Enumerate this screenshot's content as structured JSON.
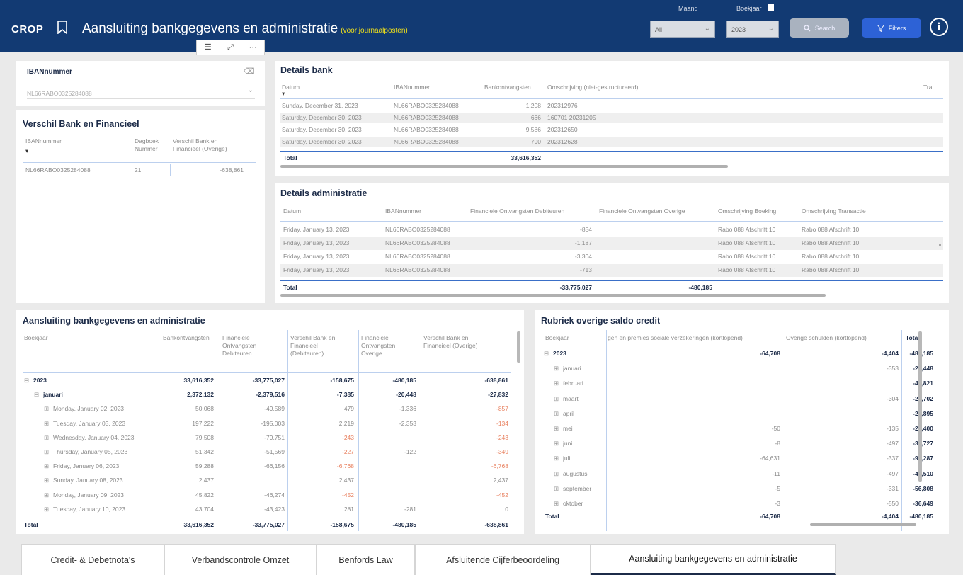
{
  "header": {
    "logo": "CROP",
    "title": "Aansluiting bankgegevens en administratie",
    "subtitle": "(voor journaalposten)",
    "maand_label": "Maand",
    "maand_value": "All",
    "boekjaar_label": "Boekjaar",
    "boekjaar_value": "2023",
    "search_label": "Search",
    "filters_label": "Filters",
    "info": "i"
  },
  "iban_slicer": {
    "title": "IBANnummer",
    "value": "NL66RABO0325284088"
  },
  "verschil": {
    "title": "Verschil Bank en Financieel",
    "col1": "IBANnummer",
    "col2a": "Dagboek",
    "col2b": "Nummer",
    "col3a": "Verschil Bank en",
    "col3b": "Financieel (Overige)",
    "row": {
      "iban": "NL66RABO0325284088",
      "dagboek": "21",
      "verschil": "-638,861"
    }
  },
  "details_bank": {
    "title": "Details bank",
    "headers": [
      "Datum",
      "IBANnummer",
      "Bankontvangsten",
      "Omschrijving (niet-gestructureerd)",
      "Tra"
    ],
    "rows": [
      [
        "Sunday, December 31, 2023",
        "NL66RABO0325284088",
        "1,208",
        "202312976"
      ],
      [
        "Saturday, December 30, 2023",
        "NL66RABO0325284088",
        "666",
        "160701 20231205"
      ],
      [
        "Saturday, December 30, 2023",
        "NL66RABO0325284088",
        "9,586",
        "202312650"
      ],
      [
        "Saturday, December 30, 2023",
        "NL66RABO0325284088",
        "790",
        "202312628"
      ]
    ],
    "total_label": "Total",
    "total_value": "33,616,352"
  },
  "details_admin": {
    "title": "Details administratie",
    "headers": [
      "Datum",
      "IBANnummer",
      "Financiele Ontvangsten Debiteuren",
      "Financiele Ontvangsten Overige",
      "Omschrijving Boeking",
      "Omschrijving Transactie"
    ],
    "rows": [
      [
        "Friday, January 13, 2023",
        "NL66RABO0325284088",
        "-854",
        "",
        "Rabo 088 Afschrift 10",
        "Rabo 088 Afschrift 10"
      ],
      [
        "Friday, January 13, 2023",
        "NL66RABO0325284088",
        "-1,187",
        "",
        "Rabo 088 Afschrift 10",
        "Rabo 088 Afschrift 10"
      ],
      [
        "Friday, January 13, 2023",
        "NL66RABO0325284088",
        "-3,304",
        "",
        "Rabo 088 Afschrift 10",
        "Rabo 088 Afschrift 10"
      ],
      [
        "Friday, January 13, 2023",
        "NL66RABO0325284088",
        "-713",
        "",
        "Rabo 088 Afschrift 10",
        "Rabo 088 Afschrift 10"
      ]
    ],
    "total_label": "Total",
    "total_deb": "-33,775,027",
    "total_ov": "-480,185"
  },
  "aansluiting": {
    "title": "Aansluiting bankgegevens en administratie",
    "headers": [
      "Boekjaar",
      "Bankontvangsten",
      "Financiele Ontvangsten Debiteuren",
      "Verschil Bank en Financieel (Debiteuren)",
      "Financiele Ontvangsten Overige",
      "Verschil Bank en Financieel (Overige)"
    ],
    "rows": [
      {
        "label": "2023",
        "level": 0,
        "toggle": "⊟",
        "bold": true,
        "v": [
          "33,616,352",
          "-33,775,027",
          "-158,675",
          "-480,185",
          "-638,861"
        ],
        "red": [
          false,
          false,
          false,
          false,
          false
        ]
      },
      {
        "label": "januari",
        "level": 1,
        "toggle": "⊟",
        "bold": true,
        "v": [
          "2,372,132",
          "-2,379,516",
          "-7,385",
          "-20,448",
          "-27,832"
        ],
        "red": [
          false,
          false,
          false,
          false,
          false
        ]
      },
      {
        "label": "Monday, January 02, 2023",
        "level": 2,
        "toggle": "⊞",
        "bold": false,
        "v": [
          "50,068",
          "-49,589",
          "479",
          "-1,336",
          "-857"
        ],
        "red": [
          false,
          false,
          false,
          false,
          true
        ]
      },
      {
        "label": "Tuesday, January 03, 2023",
        "level": 2,
        "toggle": "⊞",
        "bold": false,
        "v": [
          "197,222",
          "-195,003",
          "2,219",
          "-2,353",
          "-134"
        ],
        "red": [
          false,
          false,
          false,
          false,
          true
        ]
      },
      {
        "label": "Wednesday, January 04, 2023",
        "level": 2,
        "toggle": "⊞",
        "bold": false,
        "v": [
          "79,508",
          "-79,751",
          "-243",
          "",
          "-243"
        ],
        "red": [
          false,
          false,
          true,
          false,
          true
        ]
      },
      {
        "label": "Thursday, January 05, 2023",
        "level": 2,
        "toggle": "⊞",
        "bold": false,
        "v": [
          "51,342",
          "-51,569",
          "-227",
          "-122",
          "-349"
        ],
        "red": [
          false,
          false,
          true,
          false,
          true
        ]
      },
      {
        "label": "Friday, January 06, 2023",
        "level": 2,
        "toggle": "⊞",
        "bold": false,
        "v": [
          "59,288",
          "-66,156",
          "-6,768",
          "",
          "-6,768"
        ],
        "red": [
          false,
          false,
          true,
          false,
          true
        ]
      },
      {
        "label": "Sunday, January 08, 2023",
        "level": 2,
        "toggle": "⊞",
        "bold": false,
        "v": [
          "2,437",
          "",
          "2,437",
          "",
          "2,437"
        ],
        "red": [
          false,
          false,
          false,
          false,
          false
        ]
      },
      {
        "label": "Monday, January 09, 2023",
        "level": 2,
        "toggle": "⊞",
        "bold": false,
        "v": [
          "45,822",
          "-46,274",
          "-452",
          "",
          "-452"
        ],
        "red": [
          false,
          false,
          true,
          false,
          true
        ]
      },
      {
        "label": "Tuesday, January 10, 2023",
        "level": 2,
        "toggle": "⊞",
        "bold": false,
        "v": [
          "43,704",
          "-43,423",
          "281",
          "-281",
          "0"
        ],
        "red": [
          false,
          false,
          false,
          false,
          false
        ]
      }
    ],
    "total": [
      "Total",
      "33,616,352",
      "-33,775,027",
      "-158,675",
      "-480,185",
      "-638,861"
    ]
  },
  "rubriek": {
    "title": "Rubriek overige saldo credit",
    "headers": [
      "Boekjaar",
      "gen en premies sociale verzekeringen (kortlopend)",
      "Overige schulden (kortlopend)",
      "Total"
    ],
    "rows": [
      {
        "label": "2023",
        "level": 0,
        "toggle": "⊟",
        "bold": true,
        "v": [
          "-64,708",
          "-4,404",
          "-480,185"
        ]
      },
      {
        "label": "januari",
        "level": 1,
        "toggle": "⊞",
        "bold": false,
        "v": [
          "",
          "-353",
          "-20,448"
        ]
      },
      {
        "label": "februari",
        "level": 1,
        "toggle": "⊞",
        "bold": false,
        "v": [
          "",
          "",
          "-41,821"
        ]
      },
      {
        "label": "maart",
        "level": 1,
        "toggle": "⊞",
        "bold": false,
        "v": [
          "",
          "-304",
          "-23,702"
        ]
      },
      {
        "label": "april",
        "level": 1,
        "toggle": "⊞",
        "bold": false,
        "v": [
          "",
          "",
          "-29,895"
        ]
      },
      {
        "label": "mei",
        "level": 1,
        "toggle": "⊞",
        "bold": false,
        "v": [
          "-50",
          "-135",
          "-28,400"
        ]
      },
      {
        "label": "juni",
        "level": 1,
        "toggle": "⊞",
        "bold": false,
        "v": [
          "-8",
          "-497",
          "-30,727"
        ]
      },
      {
        "label": "juli",
        "level": 1,
        "toggle": "⊞",
        "bold": false,
        "v": [
          "-64,631",
          "-337",
          "-95,287"
        ]
      },
      {
        "label": "augustus",
        "level": 1,
        "toggle": "⊞",
        "bold": false,
        "v": [
          "-11",
          "-497",
          "-44,510"
        ]
      },
      {
        "label": "september",
        "level": 1,
        "toggle": "⊞",
        "bold": false,
        "v": [
          "-5",
          "-331",
          "-56,808"
        ]
      },
      {
        "label": "oktober",
        "level": 1,
        "toggle": "⊞",
        "bold": false,
        "v": [
          "-3",
          "-550",
          "-36,649"
        ]
      }
    ],
    "total": [
      "Total",
      "-64,708",
      "-4,404",
      "-480,185"
    ]
  },
  "tabs": [
    {
      "label": "Credit- & Debetnota's",
      "active": false
    },
    {
      "label": "Verbandscontrole Omzet",
      "active": false
    },
    {
      "label": "Benfords Law",
      "active": false
    },
    {
      "label": "Afsluitende Cijferbeoordeling",
      "active": false
    },
    {
      "label": "Aansluiting bankgegevens en administratie",
      "active": true
    }
  ],
  "colors": {
    "header": "#123a73",
    "accent_yellow": "#f1e11a",
    "filters_button": "#2d62d6",
    "negative_diff": "#e8805f"
  }
}
